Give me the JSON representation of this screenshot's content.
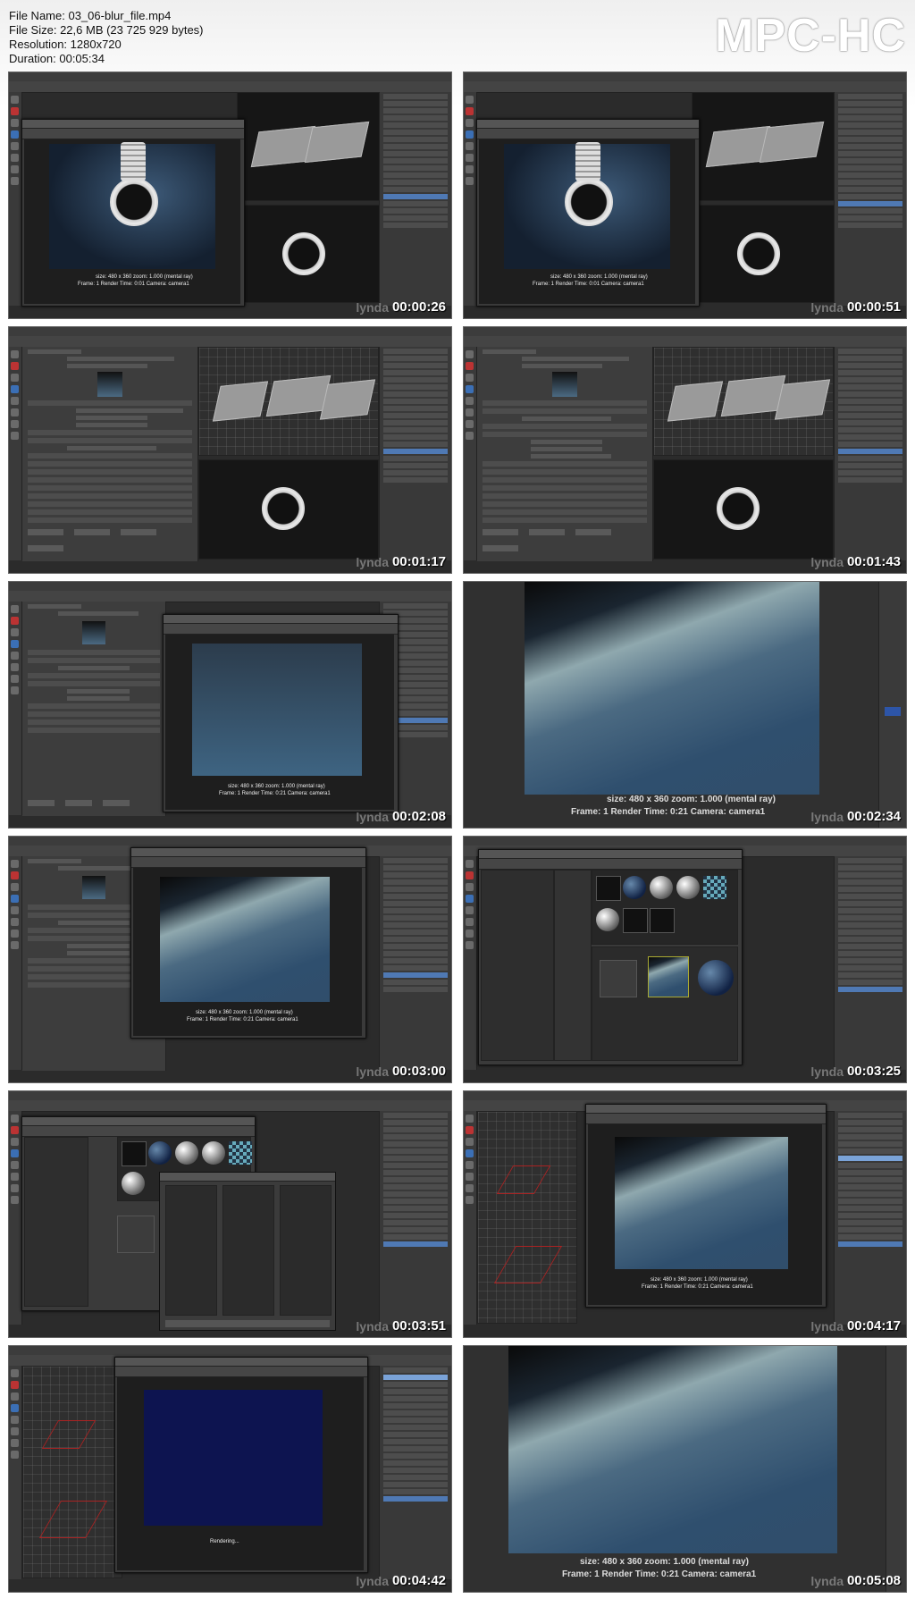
{
  "file_info": {
    "name": "File Name: 03_06-blur_file.mp4",
    "size": "File Size: 22,6 MB (23 725 929 bytes)",
    "resolution": "Resolution: 1280x720",
    "duration": "Duration: 00:05:34"
  },
  "player_logo": "MPC-HC",
  "watermark": "lynda",
  "thumbnails": [
    {
      "timecode": "00:00:26",
      "render_caption": "size: 480 x 360 zoom: 1.000 (mental ray)",
      "render_caption2": "Frame: 1 Render Time: 0:01 Camera: camera1"
    },
    {
      "timecode": "00:00:51",
      "render_caption": "size: 480 x 360 zoom: 1.000 (mental ray)",
      "render_caption2": "Frame: 1 Render Time: 0:01 Camera: camera1"
    },
    {
      "timecode": "00:01:17"
    },
    {
      "timecode": "00:01:43"
    },
    {
      "timecode": "00:02:08",
      "render_caption": "size: 480 x 360 zoom: 1.000 (mental ray)",
      "render_caption2": "Frame: 1 Render Time: 0:21 Camera: camera1"
    },
    {
      "timecode": "00:02:34",
      "render_caption": "size: 480 x 360 zoom: 1.000 (mental ray)",
      "render_caption2": "Frame: 1 Render Time: 0:21 Camera: camera1"
    },
    {
      "timecode": "00:03:00",
      "render_caption": "size: 480 x 360 zoom: 1.000 (mental ray)",
      "render_caption2": "Frame: 1 Render Time: 0:21 Camera: camera1"
    },
    {
      "timecode": "00:03:25"
    },
    {
      "timecode": "00:03:51"
    },
    {
      "timecode": "00:04:17",
      "render_caption": "size: 480 x 360 zoom: 1.000 (mental ray)",
      "render_caption2": "Frame: 1 Render Time: 0:21 Camera: camera1"
    },
    {
      "timecode": "00:04:42",
      "render_caption": "Rendering..."
    },
    {
      "timecode": "00:05:08",
      "render_caption": "size: 480 x 360 zoom: 1.000 (mental ray)",
      "render_caption2": "Frame: 1 Render Time: 0:21 Camera: camera1"
    }
  ]
}
